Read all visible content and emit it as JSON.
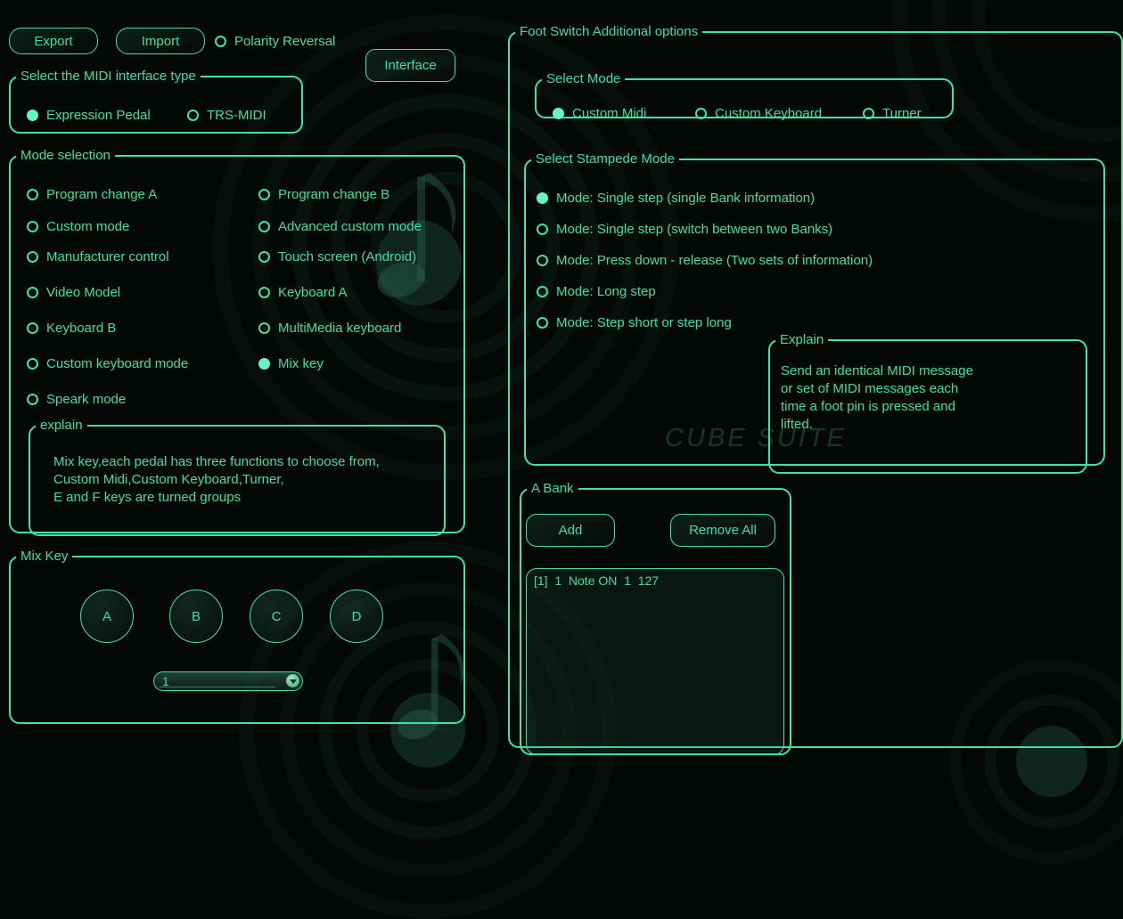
{
  "colors": {
    "accent": "#3ee3a8",
    "accent_bright": "#68f2c8",
    "text": "#3fdfa4",
    "background": "#040907"
  },
  "watermark": "CUBE SUITE",
  "toolbar": {
    "export_label": "Export",
    "import_label": "Import",
    "polarity_label": "Polarity Reversal",
    "polarity_selected": false,
    "interface_label": "Interface"
  },
  "interface_type": {
    "legend": "Select the MIDI interface type",
    "options": [
      {
        "label": "Expression Pedal",
        "selected": true
      },
      {
        "label": "TRS-MIDI",
        "selected": false
      }
    ]
  },
  "mode_selection": {
    "legend": "Mode selection",
    "options": [
      {
        "label": "Program change A",
        "selected": false
      },
      {
        "label": "Program change B",
        "selected": false
      },
      {
        "label": "Custom mode",
        "selected": false
      },
      {
        "label": "Advanced custom mode",
        "selected": false
      },
      {
        "label": "Manufacturer control",
        "selected": false
      },
      {
        "label": "Touch screen (Android)",
        "selected": false
      },
      {
        "label": "Video Model",
        "selected": false
      },
      {
        "label": "Keyboard A",
        "selected": false
      },
      {
        "label": "Keyboard B",
        "selected": false
      },
      {
        "label": "MultiMedia keyboard",
        "selected": false
      },
      {
        "label": "Custom keyboard mode",
        "selected": false
      },
      {
        "label": "Mix key",
        "selected": true
      },
      {
        "label": "Speark mode",
        "selected": false
      }
    ],
    "explain": {
      "legend": "explain",
      "lines": [
        "Mix key,each pedal has three functions to choose from,",
        "Custom Midi,Custom Keyboard,Turner,",
        "E and F keys are turned groups"
      ]
    }
  },
  "mix_key": {
    "legend": "Mix Key",
    "keys": [
      "A",
      "B",
      "C",
      "D"
    ],
    "dropdown_value": "1"
  },
  "foot_switch": {
    "legend": "Foot Switch Additional options",
    "select_mode": {
      "legend": "Select Mode",
      "options": [
        {
          "label": "Custom Midi",
          "selected": true
        },
        {
          "label": "Custom Keyboard",
          "selected": false
        },
        {
          "label": "Turner",
          "selected": false
        }
      ]
    },
    "stampede": {
      "legend": "Select Stampede Mode",
      "options": [
        {
          "label": "Mode: Single step (single Bank information)",
          "selected": true
        },
        {
          "label": "Mode: Single step (switch between two Banks)",
          "selected": false
        },
        {
          "label": "Mode: Press down - release (Two sets of information)",
          "selected": false
        },
        {
          "label": "Mode: Long step",
          "selected": false
        },
        {
          "label": "Mode: Step short or step long",
          "selected": false
        }
      ],
      "explain": {
        "legend": "Explain",
        "lines": [
          "Send an identical MIDI message",
          "or set of MIDI messages each",
          "time a foot pin is pressed and",
          "lifted."
        ]
      }
    },
    "a_bank": {
      "legend": "A Bank",
      "add_label": "Add",
      "remove_all_label": "Remove All",
      "items": [
        "[1]  1  Note ON  1  127"
      ]
    }
  }
}
